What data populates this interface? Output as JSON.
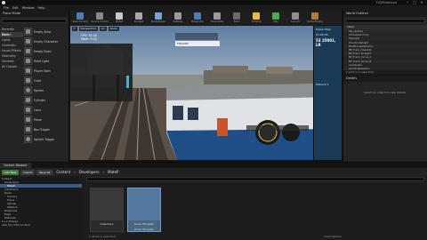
{
  "window": {
    "title": "TS2Prototype"
  },
  "menu": [
    "File",
    "Edit",
    "Window",
    "Help"
  ],
  "modes_panel": {
    "tab": "Place Mode",
    "categories": [
      "Recently Placed",
      "Basic",
      "Lights",
      "Cinematic",
      "Visual Effects",
      "Geometry",
      "Volumes",
      "All Classes"
    ],
    "selected_category": 1,
    "actors": [
      "Empty Actor",
      "Empty Character",
      "Empty Pawn",
      "Point Light",
      "Player Start",
      "Cube",
      "Sphere",
      "Cylinder",
      "Cone",
      "Plane",
      "Box Trigger",
      "Sphere Trigger"
    ]
  },
  "toolbar": {
    "buttons": [
      {
        "label": "Save Current",
        "icon": "save-icon",
        "color": "#4a7db5"
      },
      {
        "label": "Source Control",
        "icon": "source-control-icon",
        "color": "#888888"
      },
      {
        "label": "Modes",
        "icon": "modes-icon",
        "color": "#c8c8c8"
      },
      {
        "label": "Content",
        "icon": "content-icon",
        "color": "#a8a8a8"
      },
      {
        "label": "Marketplace",
        "icon": "marketplace-icon",
        "color": "#7aa3cf"
      },
      {
        "label": "Settings",
        "icon": "settings-icon",
        "color": "#9a9a9a"
      },
      {
        "label": "Blueprints",
        "icon": "blueprints-icon",
        "color": "#4a7db5"
      },
      {
        "label": "Cinematics",
        "icon": "cinematics-icon",
        "color": "#9a9a9a"
      },
      {
        "label": "Build",
        "icon": "build-icon",
        "color": "#6a6a6a"
      },
      {
        "label": "Compile",
        "icon": "compile-icon",
        "color": "#e7b84a"
      },
      {
        "label": "Play",
        "icon": "play-icon",
        "color": "#4ea64e"
      },
      {
        "label": "Launch",
        "icon": "launch-icon",
        "color": "#8e8e8e"
      },
      {
        "label": "Game Engine",
        "icon": "engine-icon",
        "color": "#b07a3a"
      }
    ]
  },
  "viewport": {
    "buttons": [
      "Perspective",
      "Lit",
      "Show"
    ],
    "overlay_lines": [
      "FPS: 30.00",
      "Mem: 9.01"
    ],
    "hud_label": "FOLLOW"
  },
  "info_strip": {
    "lines": [
      "Power Step",
      "03:00:28"
    ],
    "big": "53 25001, LR",
    "sub": "Midland 1"
  },
  "outliner": {
    "tab": "World Outliner",
    "column": "Label",
    "rows": [
      "Sky_Sphere",
      "AtmosphericFog",
      "SkyLight",
      "DirectionalLight",
      "PostProcessVolume",
      "BP_Train_Class101",
      "BP_Track_Straight",
      "BP_Track_Curve_A",
      "BP_Track_Curve_B",
      "Landscape",
      "LandscapeGizmo",
      "BP_Station_Platform",
      "BP_Signal_01",
      "BP_Signal_02"
    ],
    "footer": "4 actors (1 selected)"
  },
  "details": {
    "tab": "Details",
    "message": "Select an object to view details."
  },
  "content_browser": {
    "tabs": [
      "Content Browser"
    ],
    "add_new": "Add New",
    "import": "Import",
    "save_all": "Save All",
    "path": [
      "Content",
      "Developers",
      "MateP"
    ],
    "tree": [
      "Content",
      "Developers",
      "MateP",
      "Collections",
      "Route",
      "Scenery",
      "Trains",
      "Signals",
      "Stations",
      "Blueprints",
      "Maps",
      "Materials",
      "C++ Classes",
      "AGS_S4_YT25_Content"
    ],
    "tree_selected": 2,
    "assets": [
      {
        "name": "Collections",
        "sub": ""
      },
      {
        "name": "Route Template",
        "sub": "Route Template"
      }
    ],
    "selected_asset": 1,
    "items_count": "2 items (1 selected)",
    "view_options": "View Options"
  }
}
